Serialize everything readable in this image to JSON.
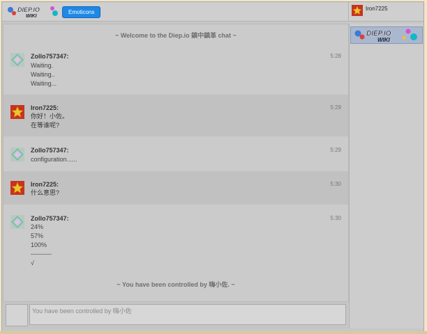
{
  "header": {
    "logo_text": "DIEP.IO WIKI",
    "emoticons_label": "Emoticons",
    "current_user": "Iron7225"
  },
  "chat": {
    "welcome": "~ Welcome to the Diep.io 鎮中鎮革 chat ~",
    "messages": [
      {
        "author": "Zollo757347:",
        "time": "5:28",
        "lines": [
          "Waiting.",
          "Waiting..",
          "Waiting..."
        ],
        "avatar": "diamond-avatar"
      },
      {
        "author": "Iron7225:",
        "time": "5:29",
        "lines": [
          "你好！小佐。",
          "在等谁呢?"
        ],
        "avatar": "star-avatar"
      },
      {
        "author": "Zollo757347:",
        "time": "5:29",
        "lines": [
          "configuration......"
        ],
        "avatar": "diamond-avatar"
      },
      {
        "author": "Iron7225:",
        "time": "5:30",
        "lines": [
          "什么意思?"
        ],
        "avatar": "star-avatar"
      },
      {
        "author": "Zollo757347:",
        "time": "5:30",
        "lines": [
          "24%",
          "57%",
          "100%",
          "----------",
          "√"
        ],
        "avatar": "diamond-avatar"
      }
    ],
    "kick_notice": "~ You have been controlled by 嗨小佐. ~"
  },
  "input": {
    "placeholder": "You have been controlled by 嗨小佐"
  }
}
